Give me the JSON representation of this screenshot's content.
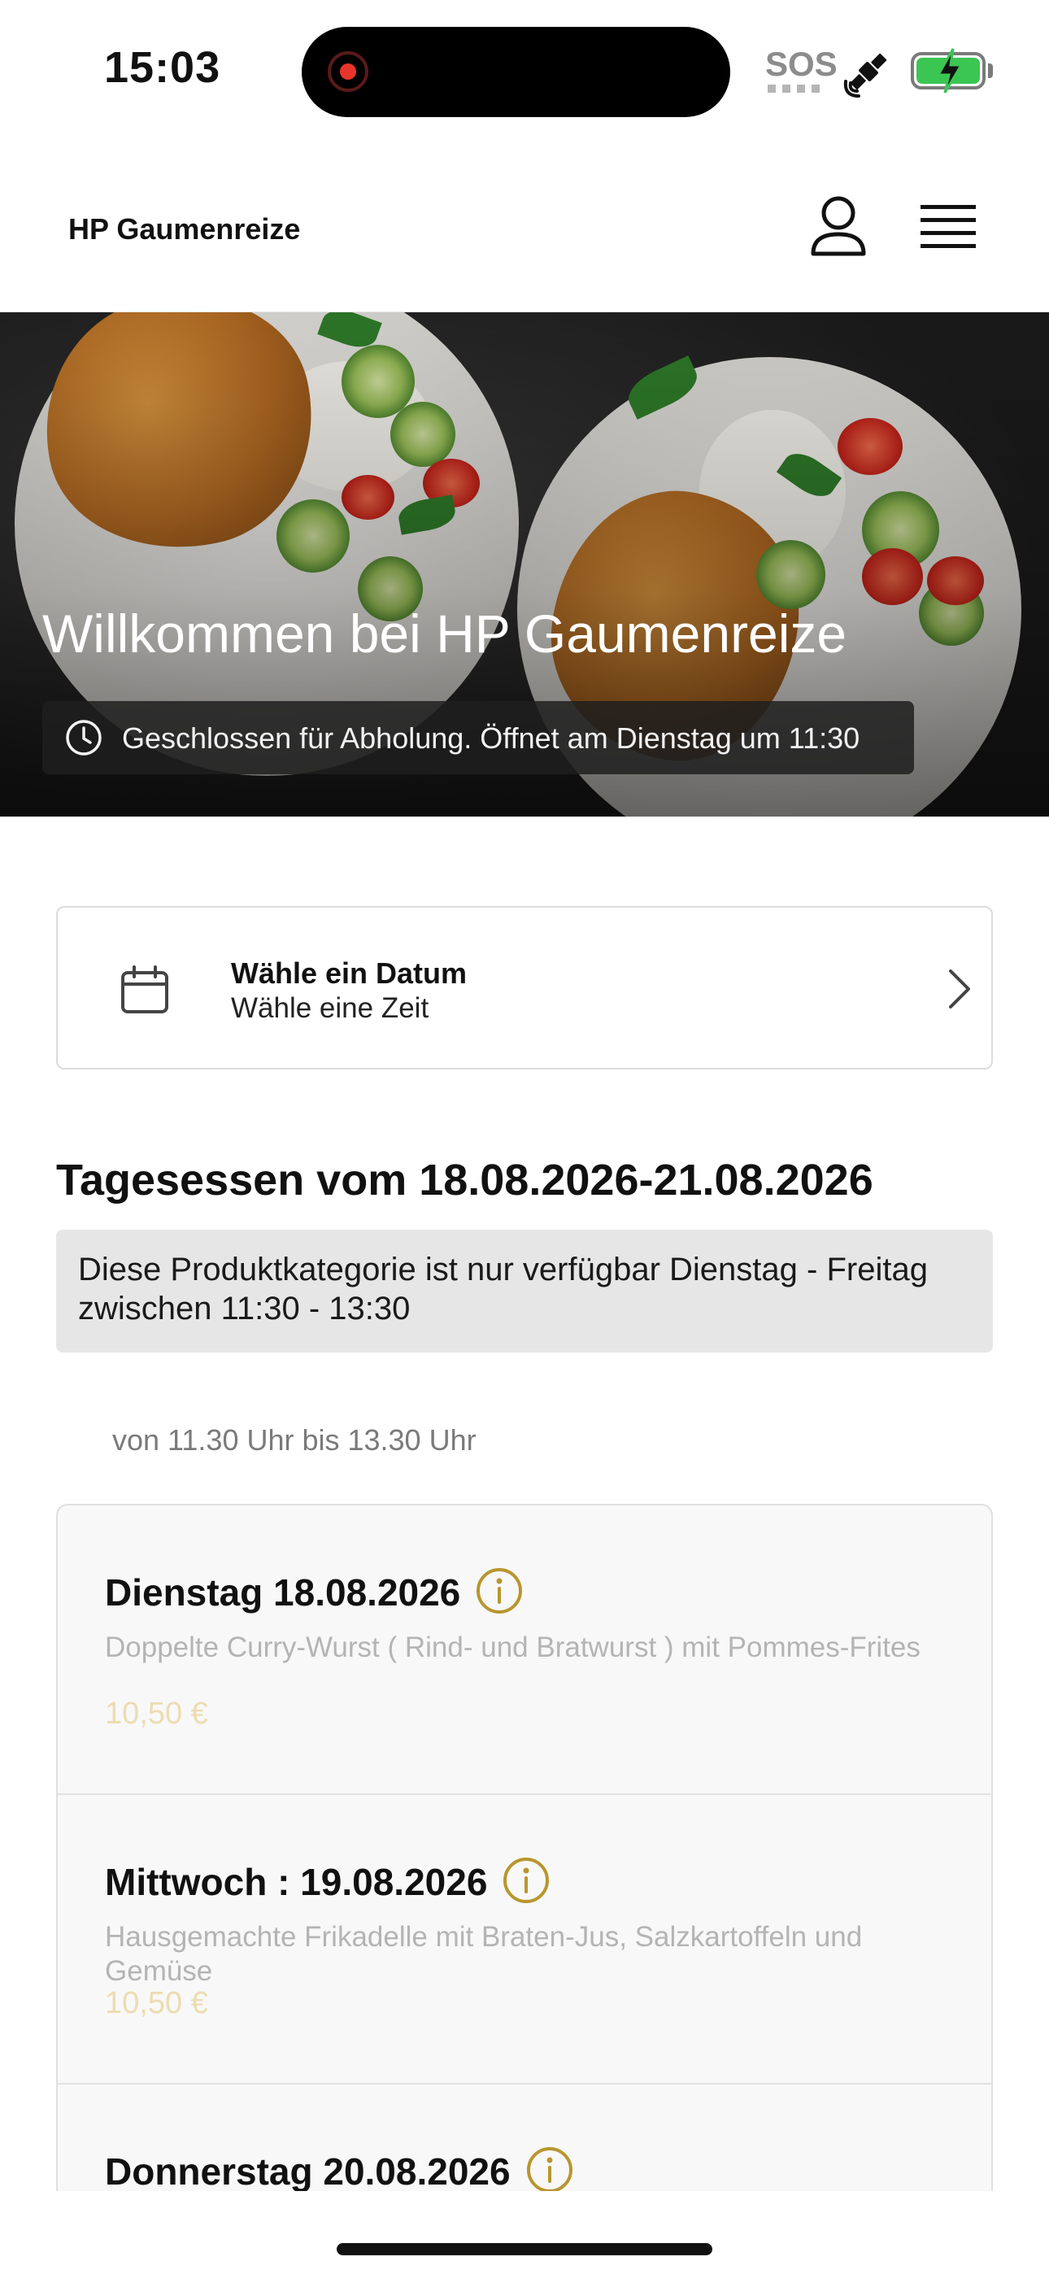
{
  "status_bar": {
    "time": "15:03",
    "sos": "SOS",
    "battery_color": "#3bc552"
  },
  "header": {
    "brand": "HP Gaumenreize",
    "icons": [
      "user-icon",
      "menu-icon"
    ]
  },
  "hero": {
    "title": "Willkommen bei HP Gaumenreize",
    "hours_notice": "Geschlossen für Abholung. Öffnet am Dienstag um 11:30"
  },
  "date_picker": {
    "title": "Wähle ein Datum",
    "subtitle": "Wähle eine Zeit"
  },
  "section": {
    "title": "Tagesessen vom 18.08.2026-21.08.2026",
    "availability": "Diese Produktkategorie ist nur verfügbar Dienstag - Freitag zwischen 11:30 - 13:30",
    "time_note": "von 11.30 Uhr bis 13.30 Uhr"
  },
  "menu_items": [
    {
      "title": "Dienstag 18.08.2026",
      "description": "Doppelte Curry-Wurst ( Rind- und Bratwurst ) mit Pommes-Frites",
      "price": "10,50 €"
    },
    {
      "title": "Mittwoch : 19.08.2026",
      "description": "Hausgemachte Frikadelle mit Braten-Jus, Salzkartoffeln und Gemüse",
      "price": "10,50 €"
    },
    {
      "title": "Donnerstag 20.08.2026",
      "description": "",
      "price": ""
    }
  ],
  "colors": {
    "accent_gold": "#b8962e",
    "price_muted": "#ecdcb0"
  }
}
